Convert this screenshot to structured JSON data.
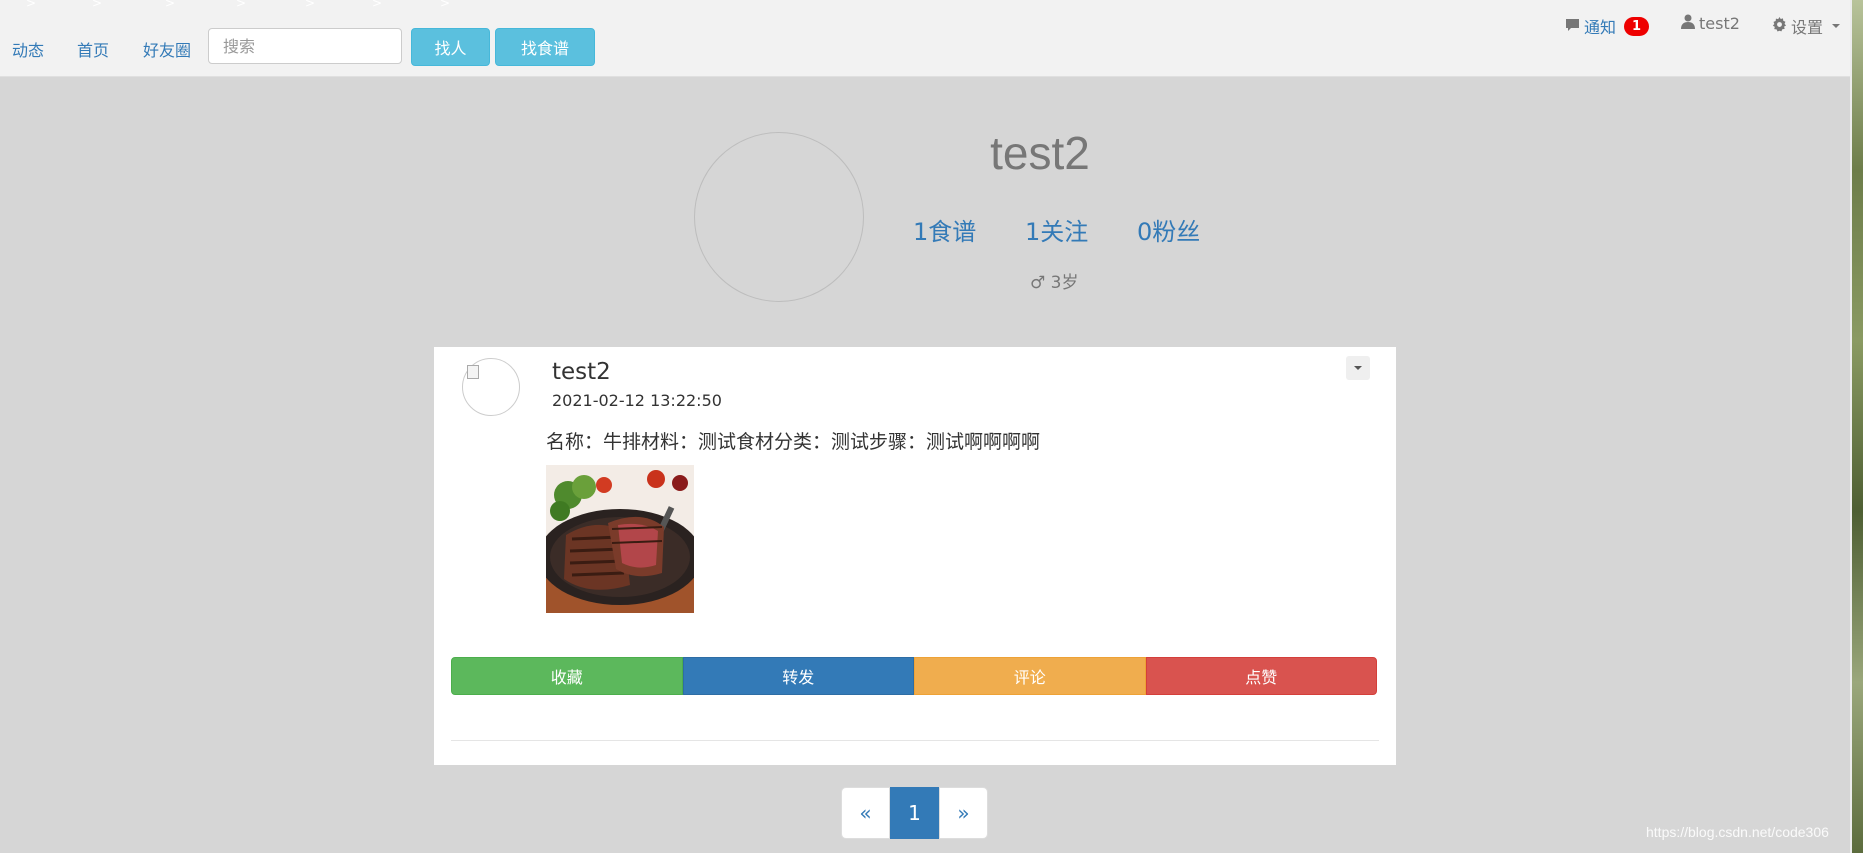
{
  "navbar": {
    "links": [
      "动态",
      "首页",
      "好友圈"
    ],
    "search_placeholder": "搜索",
    "find_people_label": "找人",
    "find_recipe_label": "找食谱",
    "notifications_label": "通知",
    "notifications_count": "1",
    "username": "test2",
    "settings_label": "设置",
    "decor_arrows": [
      ">",
      ">",
      ">",
      ">",
      ">",
      ">",
      ">"
    ]
  },
  "profile": {
    "name": "test2",
    "stats": {
      "recipes": "1食谱",
      "following": "1关注",
      "followers": "0粉丝"
    },
    "gender_age": "♂ 3岁"
  },
  "post": {
    "username": "test2",
    "time": "2021-02-12 13:22:50",
    "content": "名称：牛排材料：测试食材分类：测试步骤：测试啊啊啊啊",
    "actions": {
      "favorite": "收藏",
      "forward": "转发",
      "comment": "评论",
      "like": "点赞"
    }
  },
  "pagination": {
    "prev": "«",
    "current": "1",
    "next": "»"
  },
  "watermark": "https://blog.csdn.net/code306",
  "colors": {
    "link": "#337ab7",
    "info": "#5bc0de",
    "success": "#5cb85c",
    "primary": "#337ab7",
    "warning": "#f0ad4e",
    "danger": "#d9534f",
    "badge": "#ee0000"
  }
}
